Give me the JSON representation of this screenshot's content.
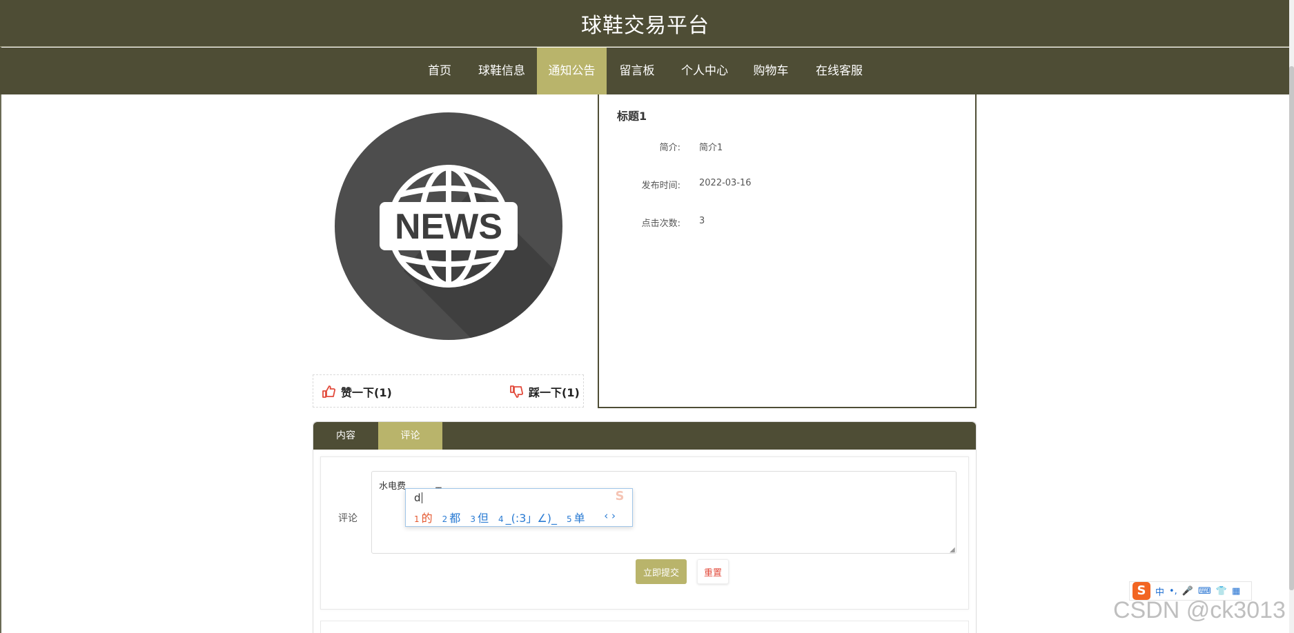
{
  "header": {
    "title": "球鞋交易平台"
  },
  "nav": {
    "items": [
      {
        "label": "首页"
      },
      {
        "label": "球鞋信息"
      },
      {
        "label": "通知公告"
      },
      {
        "label": "留言板"
      },
      {
        "label": "个人中心"
      },
      {
        "label": "购物车"
      },
      {
        "label": "在线客服"
      }
    ],
    "active": "通知公告"
  },
  "news_image": {
    "text": "NEWS",
    "icon": "globe-news-icon"
  },
  "votes": {
    "like_label": "赞一下(1)",
    "dislike_label": "踩一下(1)"
  },
  "detail": {
    "title": "标题1",
    "fields": [
      {
        "label": "简介:",
        "value": "简介1"
      },
      {
        "label": "发布时间:",
        "value": "2022-03-16"
      },
      {
        "label": "点击次数:",
        "value": "3"
      }
    ]
  },
  "tabs": [
    {
      "label": "内容"
    },
    {
      "label": "评论"
    }
  ],
  "active_tab": "评论",
  "comment_form": {
    "label": "评论",
    "value": "水电费",
    "submit_label": "立即提交",
    "reset_label": "重置"
  },
  "ime": {
    "input": "d",
    "candidates": [
      {
        "num": "1",
        "text": "的"
      },
      {
        "num": "2",
        "text": "都"
      },
      {
        "num": "3",
        "text": "但"
      },
      {
        "num": "4",
        "text": "_(:3」∠)_"
      },
      {
        "num": "5",
        "text": "单"
      }
    ],
    "arrows": "‹ ›",
    "toolbar": {
      "mode": "中",
      "punct": "•,",
      "mic": "🎤",
      "keyboard": "⌨",
      "skin": "👕",
      "apps": "▦"
    }
  },
  "watermark": "CSDN @ck3013",
  "colors": {
    "primary": "#4e4d35",
    "accent": "#b9b46b",
    "danger": "#e24a3b"
  }
}
